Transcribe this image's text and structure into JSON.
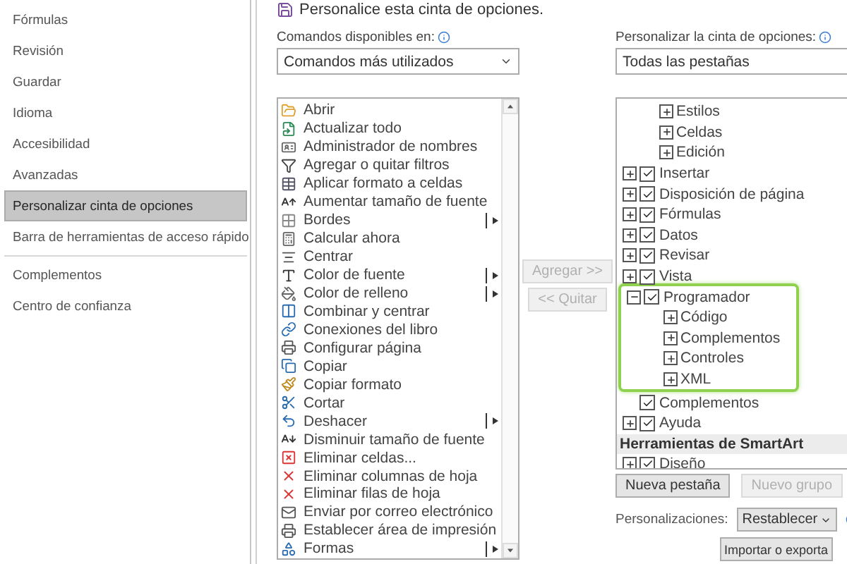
{
  "sidebar": {
    "groups": [
      [
        {
          "label": "Fórmulas",
          "selected": false
        },
        {
          "label": "Revisión",
          "selected": false
        },
        {
          "label": "Guardar",
          "selected": false
        },
        {
          "label": "Idioma",
          "selected": false
        },
        {
          "label": "Accesibilidad",
          "selected": false
        },
        {
          "label": "Avanzadas",
          "selected": false
        },
        {
          "label": "Personalizar cinta de opciones",
          "selected": true
        },
        {
          "label": "Barra de herramientas de acceso rápido",
          "selected": false
        }
      ],
      [
        {
          "label": "Complementos",
          "selected": false
        },
        {
          "label": "Centro de confianza",
          "selected": false
        }
      ]
    ]
  },
  "header": "Personalice esta cinta de opciones.",
  "commands": {
    "label": "Comandos disponibles en:",
    "dropdown": "Comandos más utilizados",
    "items": [
      {
        "label": "Abrir",
        "submenu": false
      },
      {
        "label": "Actualizar todo",
        "submenu": false
      },
      {
        "label": "Administrador de nombres",
        "submenu": false
      },
      {
        "label": "Agregar o quitar filtros",
        "submenu": false
      },
      {
        "label": "Aplicar formato a celdas",
        "submenu": false
      },
      {
        "label": "Aumentar tamaño de fuente",
        "submenu": false
      },
      {
        "label": "Bordes",
        "submenu": true
      },
      {
        "label": "Calcular ahora",
        "submenu": false
      },
      {
        "label": "Centrar",
        "submenu": false
      },
      {
        "label": "Color de fuente",
        "submenu": true
      },
      {
        "label": "Color de relleno",
        "submenu": true
      },
      {
        "label": "Combinar y centrar",
        "submenu": false
      },
      {
        "label": "Conexiones del libro",
        "submenu": false
      },
      {
        "label": "Configurar página",
        "submenu": false
      },
      {
        "label": "Copiar",
        "submenu": false
      },
      {
        "label": "Copiar formato",
        "submenu": false
      },
      {
        "label": "Cortar",
        "submenu": false
      },
      {
        "label": "Deshacer",
        "submenu": true
      },
      {
        "label": "Disminuir tamaño de fuente",
        "submenu": false
      },
      {
        "label": "Eliminar celdas...",
        "submenu": false
      },
      {
        "label": "Eliminar columnas de hoja",
        "submenu": false
      },
      {
        "label": "Eliminar filas de hoja",
        "submenu": false
      },
      {
        "label": "Enviar por correo electrónico",
        "submenu": false
      },
      {
        "label": "Establecer área de impresión",
        "submenu": false
      },
      {
        "label": "Formas",
        "submenu": true
      }
    ]
  },
  "transfer_buttons": [
    {
      "label": "Agregar >>",
      "disabled": true
    },
    {
      "label": "<< Quitar",
      "disabled": true
    }
  ],
  "ribbon": {
    "label": "Personalizar la cinta de opciones:",
    "dropdown": "Todas las pestañas",
    "tree": [
      {
        "kind": "group",
        "label": "Estilos"
      },
      {
        "kind": "group",
        "label": "Celdas"
      },
      {
        "kind": "group",
        "label": "Edición"
      },
      {
        "kind": "tab",
        "label": "Insertar",
        "checked": true,
        "expanded": false,
        "highlighted": false
      },
      {
        "kind": "tab",
        "label": "Disposición de página",
        "checked": true,
        "expanded": false,
        "highlighted": false
      },
      {
        "kind": "tab",
        "label": "Fórmulas",
        "checked": true,
        "expanded": false,
        "highlighted": false
      },
      {
        "kind": "tab",
        "label": "Datos",
        "checked": true,
        "expanded": false,
        "highlighted": false
      },
      {
        "kind": "tab",
        "label": "Revisar",
        "checked": true,
        "expanded": false,
        "highlighted": false
      },
      {
        "kind": "tab",
        "label": "Vista",
        "checked": true,
        "expanded": false,
        "highlighted": false
      },
      {
        "kind": "tab",
        "label": "Programador",
        "checked": true,
        "expanded": true,
        "highlighted": true,
        "children": [
          {
            "kind": "group",
            "label": "Código"
          },
          {
            "kind": "group",
            "label": "Complementos"
          },
          {
            "kind": "group",
            "label": "Controles"
          },
          {
            "kind": "group",
            "label": "XML"
          }
        ]
      },
      {
        "kind": "leaf",
        "label": "Complementos",
        "checked": true
      },
      {
        "kind": "tab",
        "label": "Ayuda",
        "checked": true,
        "expanded": false,
        "highlighted": false
      },
      {
        "kind": "header",
        "label": "Herramientas de SmartArt"
      },
      {
        "kind": "tab",
        "label": "Diseño",
        "checked": true,
        "expanded": false,
        "highlighted": false
      }
    ]
  },
  "tree_buttons": [
    {
      "label": "Nueva pestaña",
      "disabled": false
    },
    {
      "label": "Nuevo grupo",
      "disabled": true
    }
  ],
  "customizations": {
    "label": "Personalizaciones:",
    "reset": "Restablecer",
    "import_export": "Importar o exporta"
  }
}
